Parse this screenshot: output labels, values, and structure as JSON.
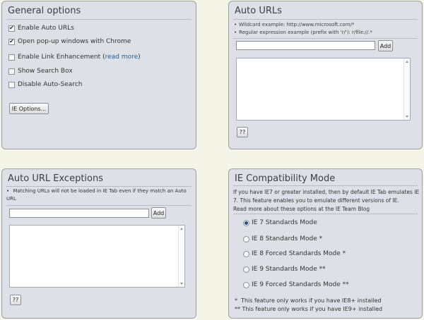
{
  "general": {
    "title": "General options",
    "options": [
      {
        "label": "Enable Auto URLs",
        "checked": true
      },
      {
        "label": "Open pop-up windows with Chrome",
        "checked": true
      },
      {
        "label": "Enable Link Enhancement",
        "checked": false,
        "link": "read more"
      },
      {
        "label": "Show Search Box",
        "checked": false
      },
      {
        "label": "Disable Auto-Search",
        "checked": false
      }
    ],
    "ie_options_button": "IE Options...",
    "read_more_prefix": "(",
    "read_more_suffix": ")"
  },
  "auto_urls": {
    "title": "Auto URLs",
    "wildcard_example": "Wildcard example: http://www.microsoft.com/*",
    "regex_example": "Regular expression example (prefix with 'r/'): r/file://.*",
    "input_value": "",
    "add_button": "Add",
    "help_button": "??"
  },
  "exceptions": {
    "title": "Auto URL Exceptions",
    "description": "Matching URLs will not be loaded in IE Tab even if they match an Auto URL",
    "input_value": "",
    "add_button": "Add",
    "help_button": "??"
  },
  "compat": {
    "title": "IE Compatibility Mode",
    "description": "If you have IE7 or greater installed, then by default IE Tab emulates IE 7. This feature enables you to emulate different versions of IE.",
    "blog_link": "Read more about these options at the IE Team Blog",
    "modes": [
      {
        "label": "IE 7 Standards Mode",
        "selected": true
      },
      {
        "label": "IE 8 Standards Mode *",
        "selected": false
      },
      {
        "label": "IE 8 Forced Standards Mode *",
        "selected": false
      },
      {
        "label": "IE 9 Standards Mode **",
        "selected": false
      },
      {
        "label": "IE 9 Forced Standards Mode **",
        "selected": false
      }
    ],
    "footnote1": "*  This feature only works if you have IE8+ installed",
    "footnote2": "** This feature only works if you have IE9+ installed"
  },
  "colors": {
    "page_bg": "#f4f5e6",
    "panel_bg": "#dde0e6",
    "link": "#2c5a8a"
  }
}
